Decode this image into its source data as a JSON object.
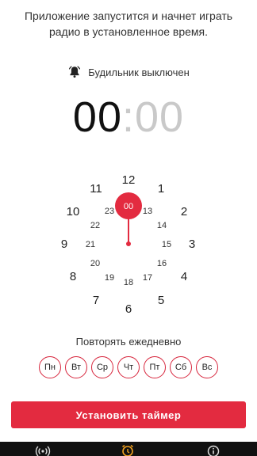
{
  "intro": {
    "line1": "Приложение запустится и начнет играть",
    "line2": "радио в установленное время."
  },
  "alarm_status": {
    "text": "Будильник выключен",
    "icon": "alarm-bell-icon"
  },
  "time": {
    "hours": "00",
    "separator": ":",
    "minutes": "00"
  },
  "dial": {
    "selected": "00",
    "outer": [
      "12",
      "1",
      "2",
      "3",
      "4",
      "5",
      "6",
      "7",
      "8",
      "9",
      "10",
      "11"
    ],
    "inner": [
      "13",
      "14",
      "15",
      "16",
      "17",
      "18",
      "19",
      "20",
      "21",
      "22",
      "23"
    ]
  },
  "repeat": {
    "label": "Повторять ежедневно",
    "days": [
      "Пн",
      "Вт",
      "Ср",
      "Чт",
      "Пт",
      "Сб",
      "Вс"
    ]
  },
  "cta_label": "Установить таймер",
  "nav": {
    "icons": [
      "radio-waves-icon",
      "alarm-clock-icon",
      "info-icon"
    ]
  },
  "colors": {
    "accent": "#e32b40",
    "day_border": "#d7263d",
    "nav_bg": "#111111"
  }
}
